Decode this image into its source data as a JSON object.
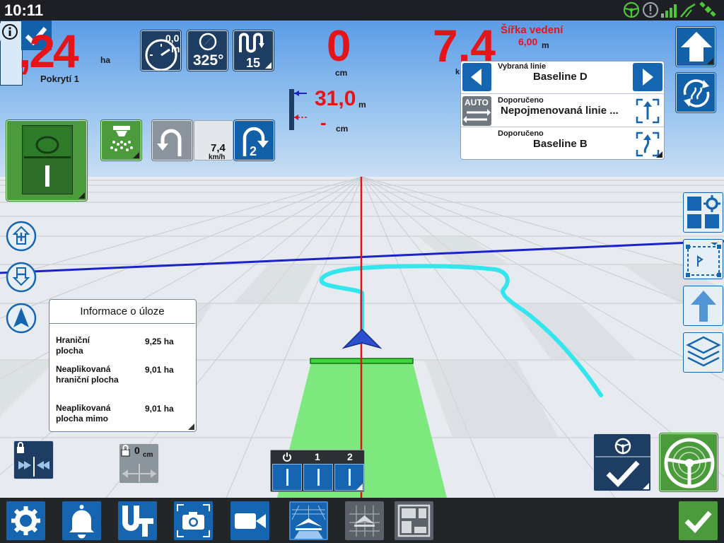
{
  "status_bar": {
    "time": "10:11"
  },
  "area": {
    "value_partial": ",24",
    "unit": "ha",
    "label": "Pokrytí 1"
  },
  "speed_widget": {
    "value": "0,0",
    "unit": "m"
  },
  "heading_widget": {
    "value": "325°"
  },
  "pattern_widget": {
    "value": "15"
  },
  "offtrack": {
    "value": "0",
    "unit": "cm"
  },
  "speed": {
    "value": "7,4",
    "unit": "km/h"
  },
  "line_width": {
    "label": "Šířka vedení",
    "value": "6,00",
    "unit": "m"
  },
  "distance": {
    "value": "31,0",
    "unit": "m",
    "dash": "-",
    "dash_unit": "cm"
  },
  "line_panel": {
    "selected_label": "Vybraná linie",
    "selected_name": "Baseline D",
    "recommended_label_1": "Doporučeno",
    "auto_label": "AUTO",
    "recommended_name_1": "Nepojmenovaná linie ...",
    "recommended_label_2": "Doporučeno",
    "recommended_name_2": "Baseline B"
  },
  "turn_widget": {
    "speed_value": "7,4",
    "speed_unit": "km/h",
    "skip_value": "2"
  },
  "task_info": {
    "title": "Informace o úloze",
    "rows": [
      {
        "label": "Hraniční plocha",
        "value": "9,25",
        "unit": "ha"
      },
      {
        "label": "Neaplikovaná hraniční plocha",
        "value": "9,01",
        "unit": "ha"
      },
      {
        "label": "Neaplikovaná plocha mimo",
        "value": "9,01",
        "unit": "ha"
      }
    ]
  },
  "shift_widget": {
    "value": "0",
    "unit": "cm"
  },
  "sections": {
    "labels": [
      "1",
      "2"
    ]
  },
  "colors": {
    "accent_blue": "#1260a8",
    "dark_blue": "#1e3d63",
    "green": "#4b9a3c",
    "red_values": "#e4141a",
    "path_cyan": "#33e6ee",
    "guidance_line": "#1a22c8"
  },
  "icons": {
    "status": [
      "steering-wheel-icon",
      "alert-icon",
      "signal-bars-icon",
      "satellite-icon"
    ],
    "bottom": [
      "settings-gear-icon",
      "bell-icon",
      "ut-icon",
      "camera-icon",
      "video-icon",
      "guidance-view-icon",
      "field-view-icon",
      "layout-icon",
      "confirm-check-icon"
    ],
    "right": [
      "layout-settings-icon",
      "boundary-icon",
      "arrow-up-icon",
      "layers-icon"
    ]
  }
}
